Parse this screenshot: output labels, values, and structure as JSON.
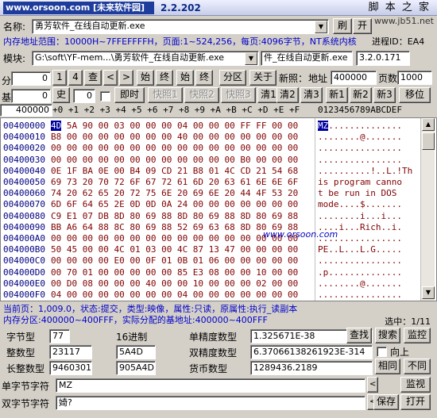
{
  "title": {
    "watermark": "www.orsoon.com [未来软件园]",
    "version": "2.2.202",
    "brand": "脚 本 之 家",
    "brand_url": "www.jb51.net"
  },
  "row1": {
    "name_label": "名称:",
    "name_value": "勇芳软件_在线自动更新.exe",
    "refresh": "刷",
    "open": "开"
  },
  "row2": {
    "info": "内存地址范围：10000H~7FFEFFFFH，页面:1~524,256，每页:4096字节，NT系统内核",
    "pid": "进程ID：EA4"
  },
  "row3": {
    "module_label": "模块:",
    "module_value": "G:\\soft\\YF-mem...\\勇芳软件_在线自动更新.exe",
    "file_value": "件_在线自动更新.exe",
    "version_value": "3.2.0.171"
  },
  "row4": {
    "fen_label": "分",
    "fen_value": "0",
    "b1": "1",
    "b4": "4",
    "cha": "查",
    "prev": "<",
    "next": ">",
    "shi1": "始",
    "zhong1": "终",
    "shi2": "始",
    "zhong2": "终",
    "fenqu": "分区",
    "guanyu": "关于",
    "xinzhao_label": "新照：",
    "addr_label": "地址",
    "addr_value": "400000",
    "pages_label": "页数",
    "pages_value": "1000"
  },
  "row5": {
    "ji_label": "基",
    "ji_value": "0",
    "shi": "史",
    "zero": "0",
    "jishi": "即时",
    "kz1": "快照1",
    "kz2": "快照2",
    "kz3": "快照3",
    "q1": "清1",
    "q2": "清2",
    "q3": "清3",
    "x1": "新1",
    "x2": "新2",
    "x3": "新3",
    "yiwei": "移位"
  },
  "hexhdr": {
    "addr": "400000",
    "offsets": "+0 +1 +2 +3 +4 +5 +6 +7 +8 +9 +A +B +C +D +E +F",
    "ascii": "0123456789ABCDEF"
  },
  "hex": {
    "addresses": "00400000\n00400010\n00400020\n00400030\n00400040\n00400050\n00400060\n00400070\n00400080\n00400090\n004000A0\n004000B0\n004000C0\n004000D0\n004000E0\n004000F0",
    "first_byte": "4D",
    "rest": " 5A 90 00 03 00 00 00 04 00 00 00 FF FF 00 00\nB8 00 00 00 00 00 00 00 40 00 00 00 00 00 00 00\n00 00 00 00 00 00 00 00 00 00 00 00 00 00 00 00\n00 00 00 00 00 00 00 00 00 00 00 00 B0 00 00 00\n0E 1F BA 0E 00 B4 09 CD 21 B8 01 4C CD 21 54 68\n69 73 20 70 72 6F 67 72 61 6D 20 63 61 6E 6E 6F\n74 20 62 65 20 72 75 6E 20 69 6E 20 44 4F 53 20\n6D 6F 64 65 2E 0D 0D 0A 24 00 00 00 00 00 00 00\nC9 E1 07 DB 8D 80 69 88 8D 80 69 88 8D 80 69 88\nBB A6 64 88 8C 80 69 88 52 69 63 68 8D 80 69 88\n00 00 00 00 00 00 00 00 00 00 00 00 00 00 00 00\n50 45 00 00 4C 01 03 00 4C 87 13 47 00 00 00 00\n00 00 00 00 E0 00 0F 01 0B 01 06 00 00 00 00 00\n00 70 01 00 00 00 00 00 85 E3 08 00 00 10 00 00\n00 D0 08 00 00 00 40 00 00 10 00 00 00 02 00 00\n04 00 00 00 00 00 00 00 04 00 00 00 00 00 00 00",
    "ascii_first": "MZ",
    "ascii_rest": "..............\n........@.......\n................\n................\n..........!..L.!Th\nis program canno\nt be run in DOS \nmode....$.......\n........i...i...\n....i...Rich..i.\n................\nPE..L...L.G.....\n................\n.p..............\n........@.......\n................"
  },
  "status": {
    "line1": "当前页：1,009.0，状态:提交，类型:映像，属性:只读，原属性:执行_读副本",
    "line2": "内存分区:400000~400FFF，实际分配的基地址:400000~400FFF",
    "selected": "选中：1/11"
  },
  "values": {
    "byte_label": "字节型",
    "byte_value": "77",
    "hex_label": "16进制",
    "hex_value": "4D",
    "single_label": "单精度数型",
    "single_value": "1.325671E-38",
    "int_label": "整数型",
    "int_value": "23117",
    "int_hex": "5A4D",
    "double_label": "双精度数型",
    "double_value": "6.37066138261923E-314",
    "long_label": "长整数型",
    "long_value": "9460301",
    "long_hex": "905A4D",
    "currency_label": "货币数型",
    "currency_value": "1289436.2189",
    "sbstr_label": "单字节字符",
    "sbstr_value": "MZ",
    "dbstr_label": "双字节字符",
    "dbstr_value": "婍?",
    "find": "查找",
    "search": "搜索",
    "monitor1": "监控",
    "up_label": "向上",
    "same": "相同",
    "diff": "不同",
    "monitor2": "监视",
    "save": "保存",
    "openbtn": "打开"
  },
  "colors": {
    "accent_blue": "#0000c8",
    "hex_text": "#800000",
    "selection": "#0000a0"
  }
}
